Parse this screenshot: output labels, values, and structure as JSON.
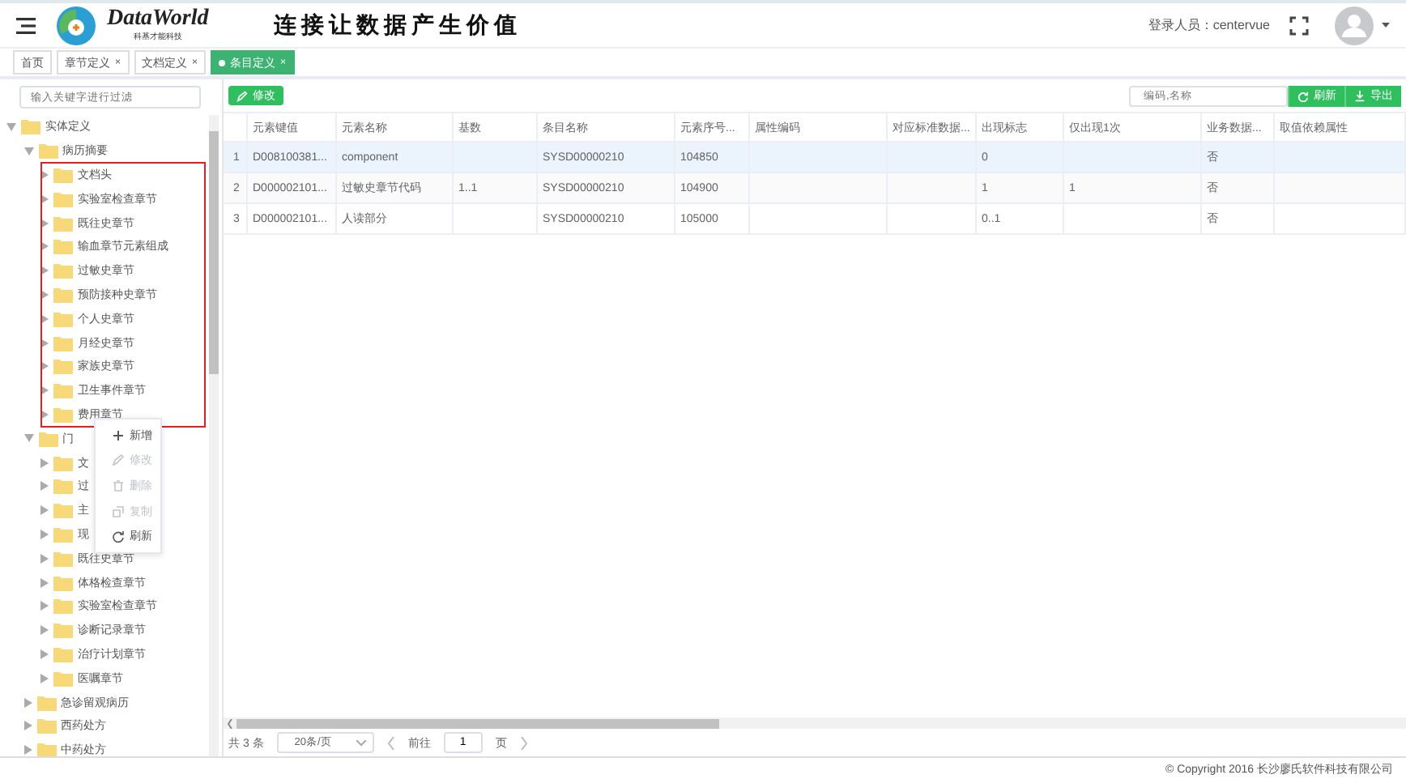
{
  "header": {
    "logo_title": "DataWorld",
    "logo_subtitle": "科基才能科技",
    "slogan": "连接让数据产生价值",
    "user_label": "登录人员：centervue"
  },
  "tabs": [
    {
      "label": "首页",
      "selected": false,
      "closable": false
    },
    {
      "label": "章节定义",
      "selected": false,
      "closable": true
    },
    {
      "label": "文档定义",
      "selected": false,
      "closable": true
    },
    {
      "label": "条目定义",
      "selected": true,
      "closable": true
    }
  ],
  "close_mark": "×",
  "tree": {
    "filter_placeholder": "输入关键字进行过滤",
    "items": [
      {
        "label": "实体定义",
        "expanded": true,
        "children": [
          {
            "label": "病历摘要",
            "expanded": true,
            "children": [
              {
                "label": "文档头",
                "expanded": false
              },
              {
                "label": "实验室检查章节",
                "expanded": false
              },
              {
                "label": "既往史章节",
                "expanded": false
              },
              {
                "label": "输血章节元素组成",
                "expanded": false
              },
              {
                "label": "过敏史章节",
                "expanded": false
              },
              {
                "label": "预防接种史章节",
                "expanded": false
              },
              {
                "label": "个人史章节",
                "expanded": false
              },
              {
                "label": "月经史章节",
                "expanded": false
              },
              {
                "label": "家族史章节",
                "expanded": false
              },
              {
                "label": "卫生事件章节",
                "expanded": false
              },
              {
                "label": "费用章节",
                "expanded": false
              }
            ]
          },
          {
            "label": "门",
            "expanded": true,
            "children": [
              {
                "label": "文",
                "expanded": false
              },
              {
                "label": "过",
                "expanded": false
              },
              {
                "label": "主",
                "expanded": false
              },
              {
                "label": "现",
                "expanded": false
              },
              {
                "label": "既往史章节",
                "expanded": false
              },
              {
                "label": "体格检查章节",
                "expanded": false
              },
              {
                "label": "实验室检查章节",
                "expanded": false
              },
              {
                "label": "诊断记录章节",
                "expanded": false
              },
              {
                "label": "治疗计划章节",
                "expanded": false
              },
              {
                "label": "医嘱章节",
                "expanded": false
              }
            ]
          },
          {
            "label": "急诊留观病历",
            "expanded": false
          },
          {
            "label": "西药处方",
            "expanded": false
          },
          {
            "label": "中药处方",
            "expanded": false
          }
        ]
      }
    ]
  },
  "context_menu": [
    {
      "label": "新增",
      "kind": "add",
      "disabled": false
    },
    {
      "label": "修改",
      "kind": "edit",
      "disabled": true
    },
    {
      "label": "删除",
      "kind": "delete",
      "disabled": true
    },
    {
      "label": "复制",
      "kind": "copy",
      "disabled": true
    },
    {
      "label": "刷新",
      "kind": "refresh",
      "disabled": false
    }
  ],
  "toolbar": {
    "edit_button": "修改",
    "search_placeholder": "编码,名称",
    "refresh_button": "刷新",
    "export_button": "导出"
  },
  "table": {
    "columns": [
      "元素键值",
      "元素名称",
      "基数",
      "条目名称",
      "元素序号...",
      "属性编码",
      "对应标准数据...",
      "出现标志",
      "仅出现1次",
      "业务数据...",
      "取值依赖属性"
    ],
    "rows": [
      {
        "index": "1",
        "selected": true,
        "cells": [
          "D008100381...",
          "component",
          "",
          "SYSD00000210",
          "104850",
          "",
          "",
          "0",
          "",
          "否",
          ""
        ]
      },
      {
        "index": "2",
        "selected": false,
        "cells": [
          "D000002101...",
          "过敏史章节代码",
          "1..1",
          "SYSD00000210",
          "104900",
          "",
          "",
          "1",
          "1",
          "否",
          ""
        ]
      },
      {
        "index": "3",
        "selected": false,
        "cells": [
          "D000002101...",
          "人读部分",
          "",
          "SYSD00000210",
          "105000",
          "",
          "",
          "0..1",
          "",
          "否",
          ""
        ]
      }
    ]
  },
  "pagination": {
    "total": "共 3 条",
    "page_size": "20条/页",
    "goto_label": "前往",
    "page": "1",
    "page_unit": "页"
  },
  "footer": "© Copyright 2016 长沙廖氏软件科技有限公司"
}
